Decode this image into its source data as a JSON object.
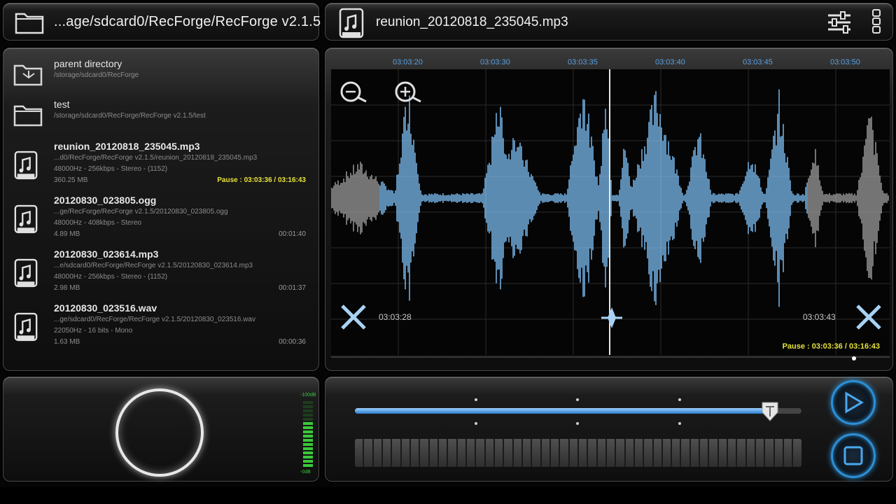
{
  "colors": {
    "accent_blue": "#2d8fd6",
    "wave_blue": "#7ab8ec",
    "wave_gray": "#9a9a9a",
    "pause_yellow": "#e6e23c",
    "vu_green": "#3ac83a"
  },
  "header": {
    "current_path": "...age/sdcard0/RecForge/RecForge v2.1.5",
    "now_playing": "reunion_20120818_235045.mp3",
    "file_type": "MP3"
  },
  "files": [
    {
      "type": "folder-up",
      "name": "parent directory",
      "path": "/storage/sdcard0/RecForge"
    },
    {
      "type": "folder",
      "name": "test",
      "path": "/storage/sdcard0/RecForge/RecForge v2.1.5/test"
    },
    {
      "type": "file",
      "name": "reunion_20120818_235045.mp3",
      "path": "...d0/RecForge/RecForge v2.1.5/reunion_20120818_235045.mp3",
      "info": "48000Hz - 256kbps - Stereo - (1152)",
      "size": "360.25 MB",
      "duration": "Pause : 03:03:36 / 03:16:43",
      "active": true
    },
    {
      "type": "file",
      "name": "20120830_023805.ogg",
      "path": "...ge/RecForge/RecForge v2.1.5/20120830_023805.ogg",
      "info": "48000Hz - 408kbps - Stereo",
      "size": "4.89 MB",
      "duration": "00:01:40"
    },
    {
      "type": "file",
      "name": "20120830_023614.mp3",
      "path": "...e/sdcard0/RecForge/RecForge v2.1.5/20120830_023614.mp3",
      "info": "48000Hz - 256kbps - Stereo - (1152)",
      "size": "2.98 MB",
      "duration": "00:01:37"
    },
    {
      "type": "file",
      "name": "20120830_023516.wav",
      "path": "...ge/sdcard0/RecForge/RecForge v2.1.5/20120830_023516.wav",
      "info": "22050Hz - 16 bits - Mono",
      "size": "1.63 MB",
      "duration": "00:00:36"
    }
  ],
  "waveform": {
    "timeline": [
      "03:03:20",
      "03:03:30",
      "03:03:35",
      "03:03:40",
      "03:03:45",
      "03:03:50"
    ],
    "selection_start": "03:03:28",
    "selection_end": "03:03:43",
    "status": "Pause : 03:03:36 / 03:16:43"
  },
  "recorder": {
    "vu_top_label": "-100dB",
    "vu_bottom_label": "-0dB"
  },
  "player": {
    "progress": 0.93
  }
}
